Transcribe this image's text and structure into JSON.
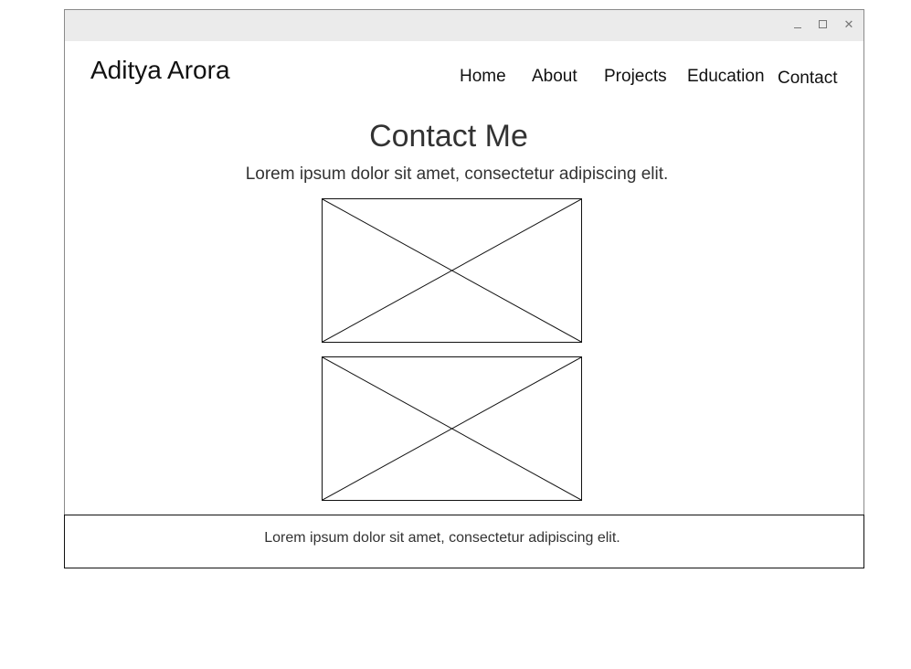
{
  "window": {
    "controls": {
      "minimize_icon": "minimize-icon",
      "maximize_icon": "maximize-icon",
      "close_glyph": "✕"
    }
  },
  "header": {
    "brand": "Aditya Arora",
    "nav": [
      {
        "label": "Home"
      },
      {
        "label": "About"
      },
      {
        "label": "Projects"
      },
      {
        "label": "Education"
      },
      {
        "label": "Contact"
      }
    ]
  },
  "main": {
    "title": "Contact Me",
    "subtitle": "Lorem ipsum dolor sit amet, consectetur adipiscing elit.",
    "images": [
      {
        "icon": "image-placeholder-icon"
      },
      {
        "icon": "image-placeholder-icon"
      }
    ]
  },
  "footer": {
    "text": "Lorem ipsum dolor sit amet, consectetur adipiscing elit."
  },
  "colors": {
    "titlebar": "#ebebeb",
    "window_border": "#8a8a8a",
    "text": "#333333"
  }
}
